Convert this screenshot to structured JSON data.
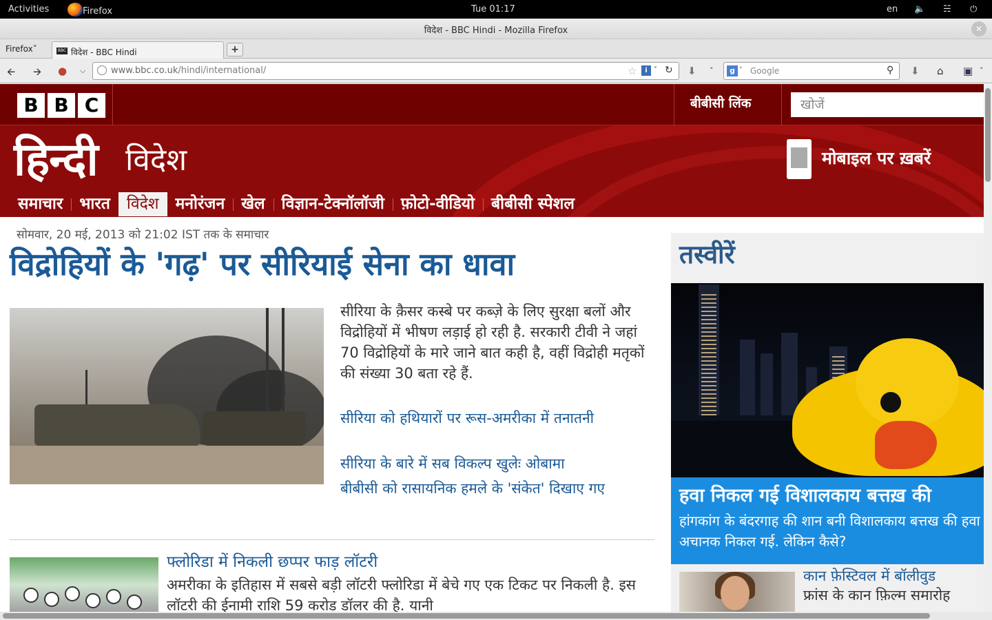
{
  "system": {
    "activities": "Activities",
    "app_name": "Firefox",
    "clock": "Tue 01:17",
    "lang": "en"
  },
  "window": {
    "title": "विदेश - BBC Hindi - Mozilla Firefox"
  },
  "tabs": {
    "menu_label": "Firefox",
    "active_tab": "विदेश - BBC Hindi",
    "favicon_text": "BBC"
  },
  "navbar": {
    "url_host": "www.bbc.co.uk",
    "url_path": "/hindi/international/",
    "search_placeholder": "Google"
  },
  "masthead": {
    "logo_letters": [
      "B",
      "B",
      "C"
    ],
    "bbc_links": "बीबीसी लिंक",
    "search_placeholder": "खोजें",
    "brand": "हिन्दी",
    "section": "विदेश",
    "mobile_news": "मोबाइल पर ख़बरें"
  },
  "menu": {
    "items": [
      {
        "label": "समाचार"
      },
      {
        "label": "भारत"
      },
      {
        "label": "विदेश"
      },
      {
        "label": "मनोरंजन"
      },
      {
        "label": "खेल"
      },
      {
        "label": "विज्ञान-टेक्नॉलॉजी"
      },
      {
        "label": "फ़ोटो-वीडियो"
      },
      {
        "label": "बीबीसी स्पेशल"
      }
    ],
    "active_index": 2
  },
  "main": {
    "timestamp": "सोमवार, 20 मई, 2013 को 21:02 IST तक के समाचार",
    "headline": "विद्रोहियों के 'गढ़' पर सीरियाई सेना का धावा",
    "lead_text": "सीरिया के क़ैसर कस्बे पर कब्ज़े के लिए सुरक्षा बलों और विद्रोहियों में भीषण लड़ाई हो रही है. सरकारी टीवी ने जहां 70 विद्रोहियों के मारे जाने बात कही है, वहीं विद्रोही मतृकों की संख्या 30 बता रहे हैं.",
    "related": [
      "सीरिया को हथियारों पर रूस-अमरीका में तनातनी",
      "सीरिया के बारे में सब विकल्प खुलेः ओबामा",
      "बीबीसी को रासायनिक हमले के 'संकेत' दिखाए गए"
    ],
    "story2_title": "फ्लोरिडा में निकली छप्पर फाड़ लॉटरी",
    "story2_text": "अमरीका के इतिहास में सबसे बड़ी लॉटरी फ्लोरिडा में बेचे गए एक टिकट पर निकली है. इस लॉटरी की ईनामी राशि 59 करोड़ डॉलर की है. यानी"
  },
  "sidebar": {
    "title": "तस्वीरें",
    "feature_title": "हवा निकल गई विशालकाय बत्तख़ की",
    "feature_text": "हांगकांग के बंदरगाह की शान बनी विशालकाय बत्तख की हवा अचानक निकल गई. लेकिन कैसे?",
    "item2_title": "कान फ़ेस्टिवल में बॉलीवुड",
    "item2_text": "फ्रांस के कान फ़िल्म समारोह"
  }
}
